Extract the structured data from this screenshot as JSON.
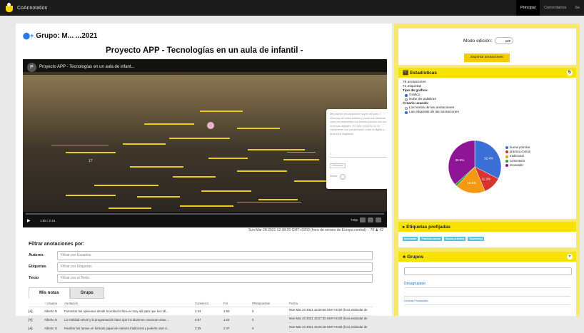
{
  "topbar": {
    "brand": "CoAnnotation",
    "nav": [
      {
        "label": "Principal",
        "active": true
      },
      {
        "label": "Comentarios",
        "active": false
      },
      {
        "label": "Se",
        "active": false
      }
    ]
  },
  "left": {
    "group_title": "Grupo: M... ...2021",
    "video_title": "Proyecto APP - Tecnologías en un aula de infantil -",
    "video_header": "Proyecto APP - Tecnologías en un aula de infant...",
    "marker_number": "17",
    "popup": {
      "text": "Me parece una aplicación super útil para 7 niños/as de estas edades y podemos observar como es realmente una buena práctica con los recursos digitales. En este proyecto se ve claramente una combinación entre lo digital y la lección magistral.",
      "field_placeholder": "E...",
      "button_label": "Detectado",
      "share_label": "Share:"
    },
    "controls": {
      "time": "1:56 / 2:16",
      "quality": "720p"
    },
    "status_line": "Sun Mar 28 2021 12:38:25 GMT+0200 (hora de verano de Europa central)  ◌ 78  ♟ 42",
    "filter_title": "Filtrar anotaciones por:",
    "filters": [
      {
        "label": "Autores",
        "placeholder": "Filtrar por Usuarios"
      },
      {
        "label": "Etiquetas",
        "placeholder": "Filtrar por Etiquetas"
      },
      {
        "label": "Texto",
        "placeholder": "Filtrar por el Texto"
      }
    ],
    "tabs": [
      {
        "label": "Mis notas",
        "active": true
      },
      {
        "label": "Grupo",
        "active": false
      }
    ],
    "table": {
      "headers": [
        "",
        "↑ Usuario",
        "Anotación",
        "Comienzo",
        "Fin",
        "#Respuestas",
        "Fecha"
      ],
      "rows": [
        [
          "[+]",
          "Alberto N",
          "Fomentar las opiniones desde la actitud crítica es muy útil para que los niñ...",
          "1:34",
          "1:50",
          "0",
          "Mon Mar 22 2021 19:28:56 GMT+0100 (hora estándar de ..."
        ],
        [
          "[+]",
          "Alberto N",
          "La realidad virtual y la programación hace que los alumnos conozcan otras ...",
          "0:57",
          "1:15",
          "0",
          "Mon Mar 22 2021 19:27:30 GMT+0100 (hora estándar de ..."
        ],
        [
          "[+]",
          "Alberto G",
          "Realizar las tareas en formato papel de manera tradicional y poderla usar d...",
          "2:29",
          "2:47",
          "0",
          "Mon Mar 22 2021 19:26:18 GMT+0100 (hora estándar de ..."
        ]
      ]
    }
  },
  "right": {
    "mode_label": "Modo edición:",
    "mode_toggle": "OFF",
    "export_label": "Exportar anotaciones",
    "stats": {
      "header": "Estadísticas",
      "annotations": "78 anotaciones",
      "labels": "71 etiquetas",
      "chart_type_label": "Tipo de gráfico:",
      "opt_graph": "Gráfico",
      "opt_cloud": "Nube de palabras",
      "create_label": "Crearlo usando:",
      "opt_texts": "Los textos de las anotaciones",
      "opt_tags": "Las etiquetas de las anotaciones"
    },
    "tags": {
      "header": "Etiquetas prefijadas",
      "items": [
        "Innovador",
        "Práctica común",
        "Buena práctica",
        "Tradicional"
      ]
    },
    "groups": {
      "header": "Grupos",
      "items": [
        {
          "label": "Desagrupado",
          "sub": ""
        },
        {
          "label": "",
          "sub": "..."
        },
        {
          "label": "Lecturas Procesuales",
          "sub": ""
        }
      ]
    }
  },
  "colors": {
    "accent_yellow": "#f7e300",
    "panel_yellow": "#f7e96a",
    "buena_practica": "#3a6fd6",
    "practica_comun": "#d7332f",
    "tradicional": "#f49a12",
    "comentario": "#2aa13c",
    "innovador": "#8e1595"
  },
  "chart_data": {
    "type": "pie",
    "categories": [
      "buena práctica",
      "práctica común",
      "tradicional",
      "comentario",
      "innovador"
    ],
    "values": [
      32.4,
      11.3,
      18.3,
      1.4,
      36.6
    ],
    "labels_shown": [
      "32.4%",
      "11.3%",
      "18.3%",
      "",
      "36.6%"
    ],
    "legend": "right"
  }
}
